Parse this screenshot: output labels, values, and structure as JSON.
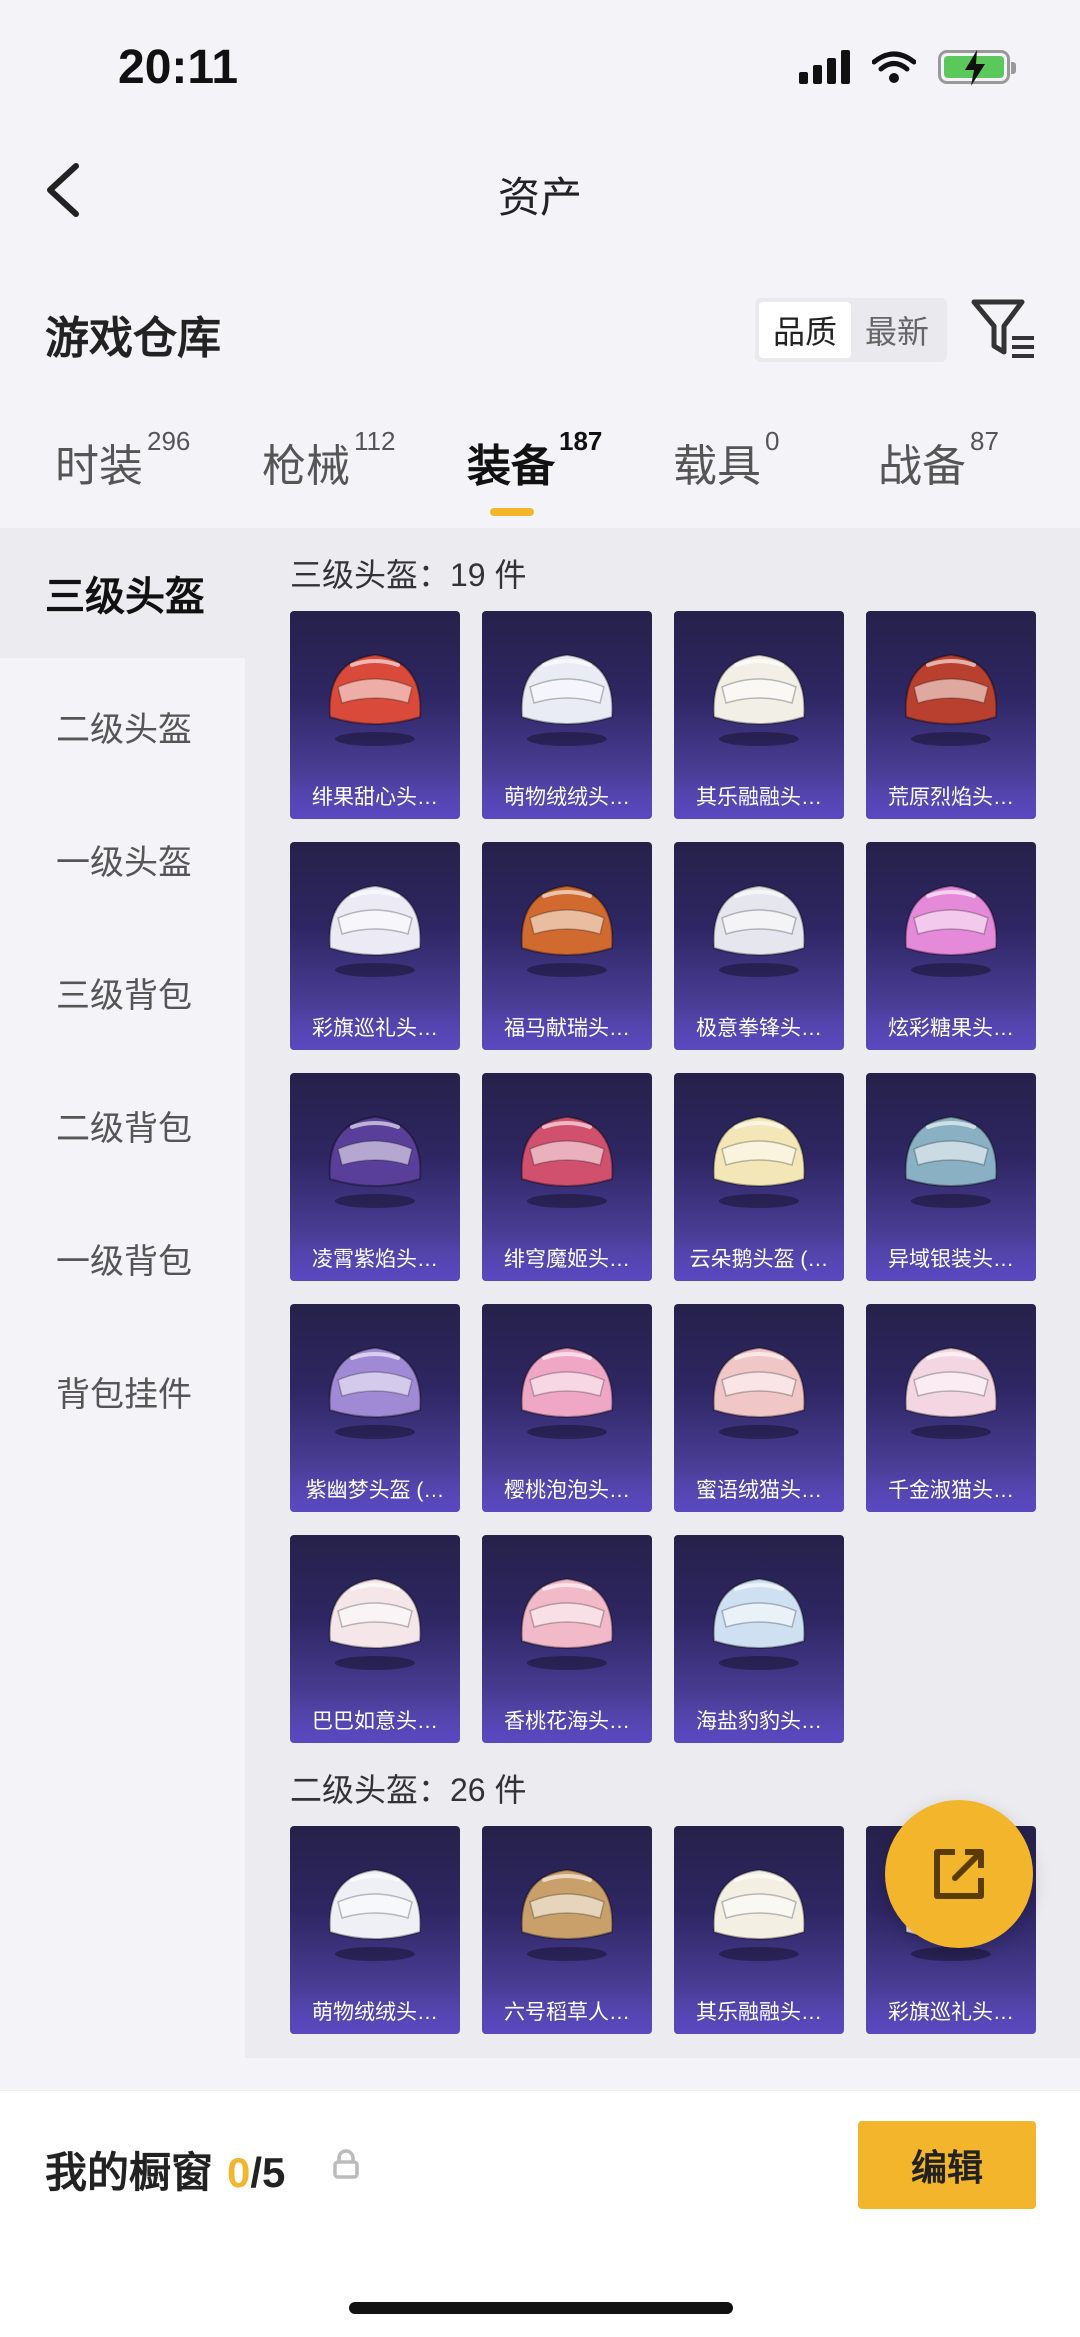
{
  "status": {
    "time": "20:11"
  },
  "nav": {
    "title": "资产"
  },
  "header": {
    "title": "游戏仓库",
    "sort_options": [
      "品质",
      "最新"
    ]
  },
  "tabs": [
    {
      "label": "时装",
      "count": "296"
    },
    {
      "label": "枪械",
      "count": "112"
    },
    {
      "label": "装备",
      "count": "187"
    },
    {
      "label": "载具",
      "count": "0"
    },
    {
      "label": "战备",
      "count": "87"
    }
  ],
  "sidebar": [
    "三级头盔",
    "二级头盔",
    "一级头盔",
    "三级背包",
    "二级背包",
    "一级背包",
    "背包挂件"
  ],
  "sections": [
    {
      "title": "三级头盔：19 件",
      "items": [
        {
          "name": "绯果甜心头…",
          "color": "#d94a3a"
        },
        {
          "name": "萌物绒绒头…",
          "color": "#e9ecf5"
        },
        {
          "name": "其乐融融头…",
          "color": "#f2efe6"
        },
        {
          "name": "荒原烈焰头…",
          "color": "#b9402e"
        },
        {
          "name": "彩旗巡礼头…",
          "color": "#eceaf5"
        },
        {
          "name": "福马献瑞头…",
          "color": "#d06a2e"
        },
        {
          "name": "极意拳锋头…",
          "color": "#e6e6ee"
        },
        {
          "name": "炫彩糖果头…",
          "color": "#e58ad9"
        },
        {
          "name": "凌霄紫焰头…",
          "color": "#5a3f9a"
        },
        {
          "name": "绯穹魔姬头…",
          "color": "#d0506e"
        },
        {
          "name": "云朵鹅头盔 (…",
          "color": "#f3e7b8"
        },
        {
          "name": "异域银装头…",
          "color": "#8ab0c4"
        },
        {
          "name": "紫幽梦头盔 (…",
          "color": "#a08ad6"
        },
        {
          "name": "樱桃泡泡头…",
          "color": "#f0a7c6"
        },
        {
          "name": "蜜语绒猫头…",
          "color": "#f1c6c6"
        },
        {
          "name": "千金淑猫头…",
          "color": "#f3d6e2"
        },
        {
          "name": "巴巴如意头…",
          "color": "#f5e6ea"
        },
        {
          "name": "香桃花海头…",
          "color": "#f2b9c8"
        },
        {
          "name": "海盐豹豹头…",
          "color": "#cfe0f2"
        }
      ]
    },
    {
      "title": "二级头盔：26 件",
      "items": [
        {
          "name": "萌物绒绒头…",
          "color": "#eef0f6"
        },
        {
          "name": "六号稻草人…",
          "color": "#c9a06a"
        },
        {
          "name": "其乐融融头…",
          "color": "#f4efe3"
        },
        {
          "name": "彩旗巡礼头…",
          "color": "#e8e6f3"
        }
      ]
    }
  ],
  "showcase": {
    "label": "我的橱窗",
    "current": "0",
    "total": "/5"
  },
  "edit_label": "编辑",
  "colors": {
    "accent": "#f2b52b",
    "card_top": "#26214a",
    "card_bottom": "#5a4bb4"
  }
}
